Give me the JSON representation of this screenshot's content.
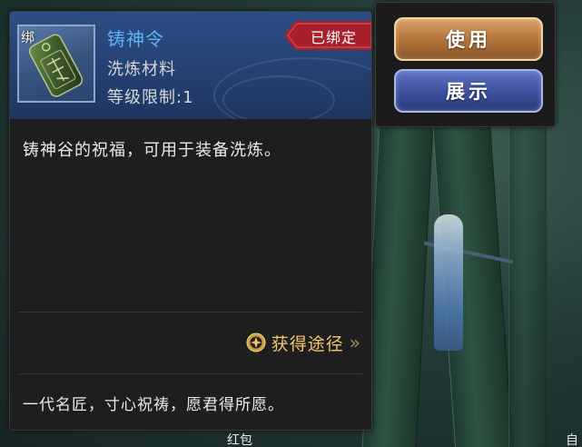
{
  "item": {
    "bind_mark": "绑",
    "name": "铸神令",
    "type": "洗炼材料",
    "level_requirement": "等级限制:1",
    "bound_status": "已绑定",
    "description": "铸神谷的祝福，可用于装备洗炼。",
    "source_label": "获得途径",
    "source_arrow": "»",
    "flavor_text": "一代名匠，寸心祝祷，愿君得所愿。",
    "name_color": "#5fb3f3",
    "icon": "token-icon"
  },
  "actions": {
    "use_label": "使用",
    "show_label": "展示"
  },
  "scene": {
    "label_bottom": "红包",
    "label_right": "自"
  }
}
